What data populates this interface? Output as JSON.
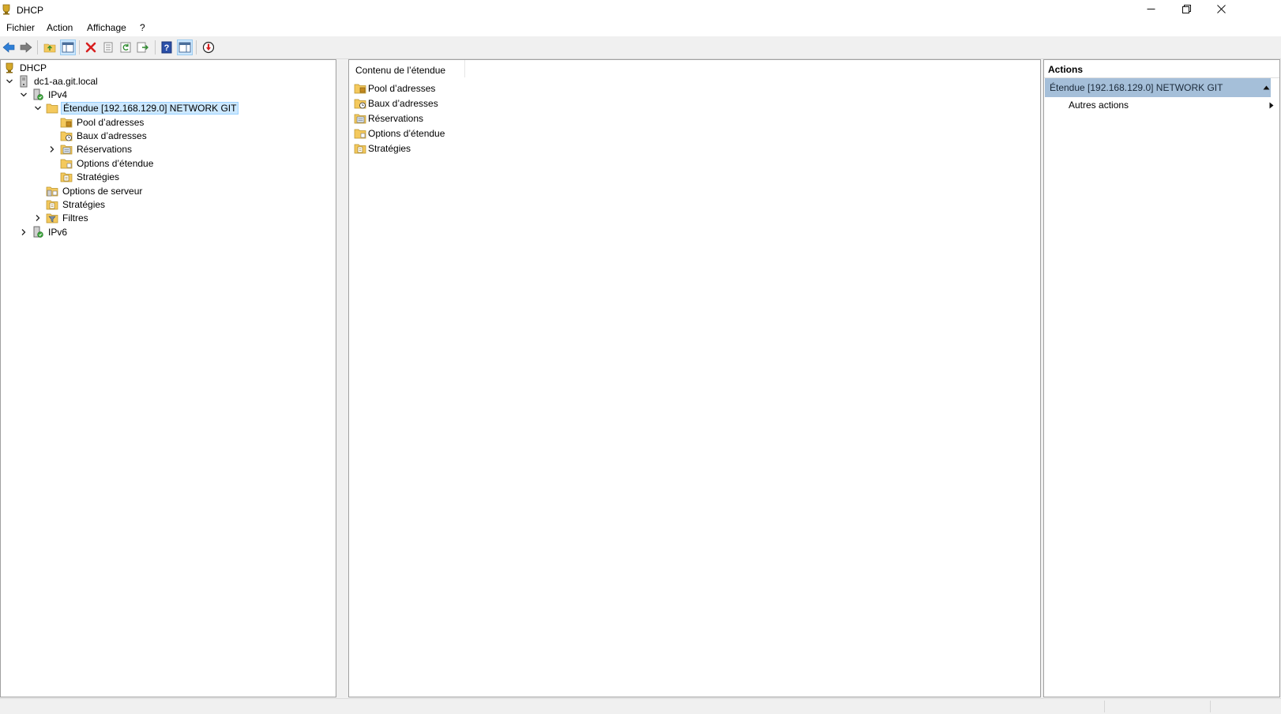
{
  "window": {
    "title": "DHCP"
  },
  "menu": [
    "Fichier",
    "Action",
    "Affichage",
    "?"
  ],
  "toolbar": {
    "icons": [
      "back-arrow-icon",
      "forward-arrow-icon",
      "up-folder-icon",
      "show-hide-tree-icon",
      "delete-icon",
      "properties-icon",
      "refresh-icon",
      "export-list-icon",
      "help-icon",
      "show-hide-action-pane-icon",
      "stop-server-icon"
    ]
  },
  "tree": {
    "root": "DHCP",
    "server": "dc1-aa.git.local",
    "ipv4": "IPv4",
    "scope": "Étendue [192.168.129.0] NETWORK GIT",
    "scope_children": [
      "Pool d’adresses",
      "Baux d’adresses",
      "Réservations",
      "Options d’étendue",
      "Stratégies"
    ],
    "server_options": "Options de serveur",
    "policies": "Stratégies",
    "filters": "Filtres",
    "ipv6": "IPv6"
  },
  "list": {
    "header": "Contenu de l’étendue",
    "items": [
      "Pool d’adresses",
      "Baux d’adresses",
      "Réservations",
      "Options d’étendue",
      "Stratégies"
    ]
  },
  "actions": {
    "header": "Actions",
    "section": "Étendue [192.168.129.0] NETWORK GIT",
    "item": "Autres actions"
  },
  "colors": {
    "selection_bg": "#cce8ff",
    "actions_section_bg": "#a5bfd9",
    "folder": "#f4c95d"
  }
}
